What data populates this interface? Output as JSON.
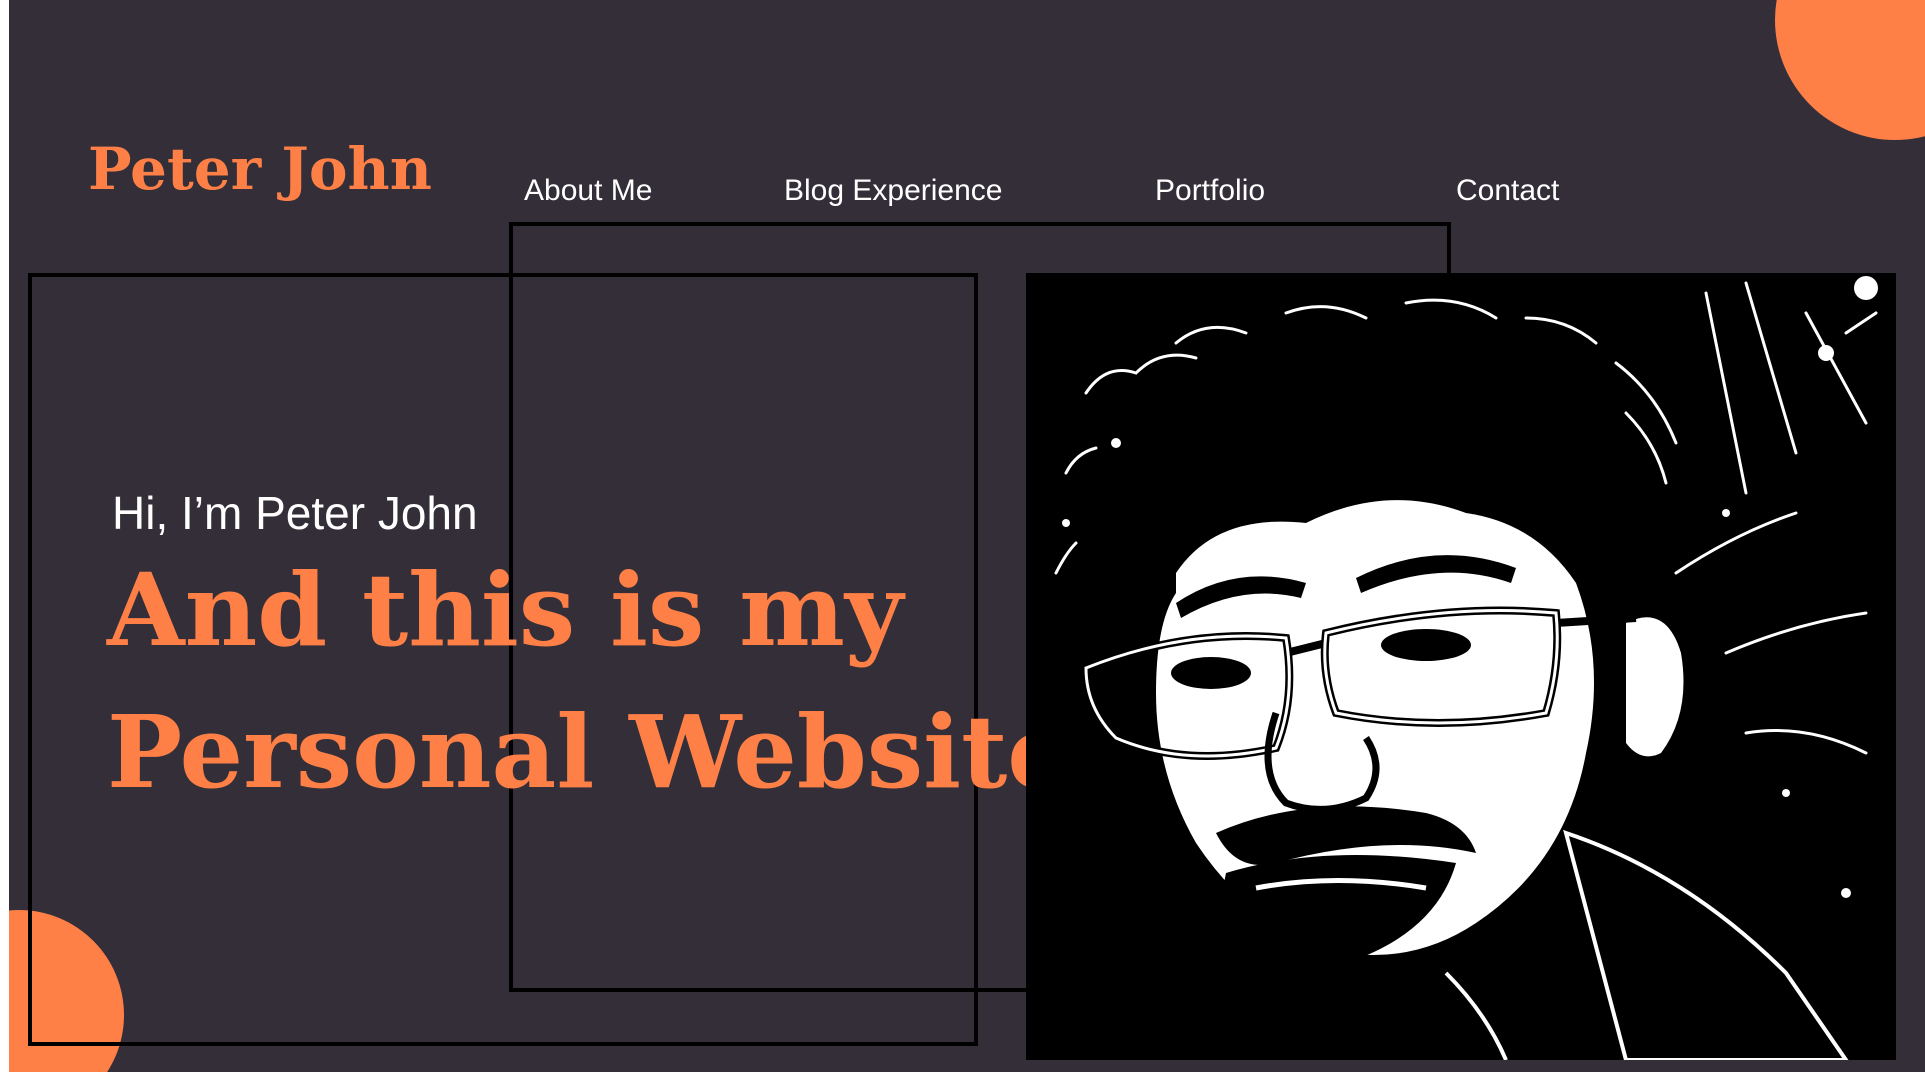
{
  "brand": {
    "name": "Peter John"
  },
  "nav": {
    "items": [
      {
        "label": "About Me"
      },
      {
        "label": "Blog Experience"
      },
      {
        "label": "Portfolio"
      },
      {
        "label": "Contact"
      }
    ]
  },
  "hero": {
    "greeting": "Hi, I’m Peter John",
    "headline_line1": "And this is my",
    "headline_line2": "Personal Website",
    "portrait_icon": "person-portrait-icon"
  },
  "colors": {
    "background": "#332e38",
    "accent": "#ff8047",
    "text": "#ffffff",
    "frame": "#000000"
  }
}
